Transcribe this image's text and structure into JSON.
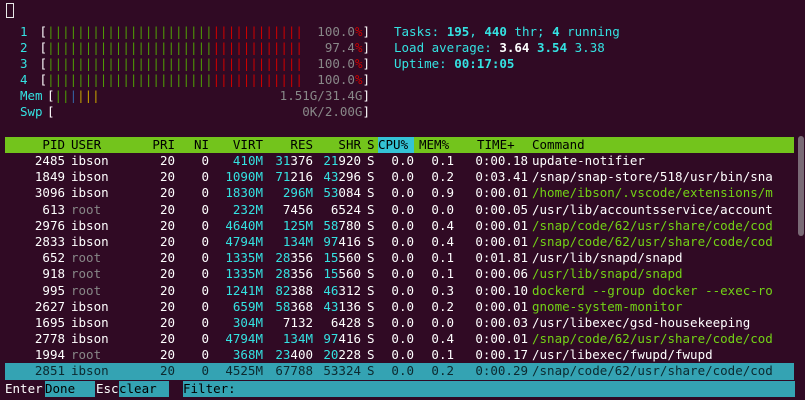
{
  "cpu_meters": [
    {
      "label": "1",
      "bars": "||||||||||||||||||||||||||||||||||",
      "value": "100.0%"
    },
    {
      "label": "2",
      "bars": "||||||||||||||||||||||||||||||||||",
      "value": "97.4%"
    },
    {
      "label": "3",
      "bars": "||||||||||||||||||||||||||||||||||",
      "value": "100.0%"
    },
    {
      "label": "4",
      "bars": "||||||||||||||||||||||||||||||||||",
      "value": "100.0%"
    }
  ],
  "mem": {
    "label": "Mem",
    "value": "1.51G/31.4G"
  },
  "swp": {
    "label": "Swp",
    "value": "0K/2.00G"
  },
  "summary": {
    "tasks_label": "Tasks: ",
    "tasks": "195",
    "sep1": ", ",
    "threads": "440",
    "thr_label": " thr; ",
    "running": "4",
    "running_label": " running",
    "load_label": "Load average: ",
    "load1": "3.64",
    "load5": "3.54",
    "load15": "3.38",
    "uptime_label": "Uptime: ",
    "uptime": "00:17:05"
  },
  "header": {
    "pid": "PID",
    "user": "USER",
    "pri": "PRI",
    "ni": "NI",
    "virt": "VIRT",
    "res": "RES",
    "shr": "SHR",
    "s": "S",
    "cpu": "CPU%",
    "mem": "MEM%",
    "time": "TIME+",
    "cmd": "Command"
  },
  "processes": [
    {
      "pid": "2485",
      "user": "ibson",
      "pri": "20",
      "ni": "0",
      "virt": "410M",
      "res": "31376",
      "shr": "21920",
      "s": "S",
      "cpu": "0.0",
      "mem": "0.1",
      "time": "0:00.18",
      "cmd": "update-notifier",
      "cmd_color": "white"
    },
    {
      "pid": "1849",
      "user": "ibson",
      "pri": "20",
      "ni": "0",
      "virt": "1090M",
      "res": "71216",
      "shr": "43296",
      "s": "S",
      "cpu": "0.0",
      "mem": "0.2",
      "time": "0:03.41",
      "cmd": "/snap/snap-store/518/usr/bin/sna",
      "cmd_color": "white"
    },
    {
      "pid": "3096",
      "user": "ibson",
      "pri": "20",
      "ni": "0",
      "virt": "1830M",
      "res": "296M",
      "shr": "53084",
      "s": "S",
      "cpu": "0.0",
      "mem": "0.9",
      "time": "0:00.01",
      "cmd": "/home/ibson/.vscode/extensions/m",
      "cmd_color": "green"
    },
    {
      "pid": "613",
      "user": "root",
      "pri": "20",
      "ni": "0",
      "virt": "232M",
      "res": "7456",
      "shr": "6524",
      "s": "S",
      "cpu": "0.0",
      "mem": "0.0",
      "time": "0:00.05",
      "cmd": "/usr/lib/accountsservice/account",
      "cmd_color": "white"
    },
    {
      "pid": "2976",
      "user": "ibson",
      "pri": "20",
      "ni": "0",
      "virt": "4640M",
      "res": "125M",
      "shr": "58780",
      "s": "S",
      "cpu": "0.0",
      "mem": "0.4",
      "time": "0:00.01",
      "cmd": "/snap/code/62/usr/share/code/cod",
      "cmd_color": "green"
    },
    {
      "pid": "2833",
      "user": "ibson",
      "pri": "20",
      "ni": "0",
      "virt": "4794M",
      "res": "134M",
      "shr": "97416",
      "s": "S",
      "cpu": "0.0",
      "mem": "0.4",
      "time": "0:00.01",
      "cmd": "/snap/code/62/usr/share/code/cod",
      "cmd_color": "green"
    },
    {
      "pid": "652",
      "user": "root",
      "pri": "20",
      "ni": "0",
      "virt": "1335M",
      "res": "28356",
      "shr": "15560",
      "s": "S",
      "cpu": "0.0",
      "mem": "0.1",
      "time": "0:01.81",
      "cmd": "/usr/lib/snapd/snapd",
      "cmd_color": "white"
    },
    {
      "pid": "918",
      "user": "root",
      "pri": "20",
      "ni": "0",
      "virt": "1335M",
      "res": "28356",
      "shr": "15560",
      "s": "S",
      "cpu": "0.0",
      "mem": "0.1",
      "time": "0:00.06",
      "cmd": "/usr/lib/snapd/snapd",
      "cmd_color": "green"
    },
    {
      "pid": "995",
      "user": "root",
      "pri": "20",
      "ni": "0",
      "virt": "1241M",
      "res": "82388",
      "shr": "46312",
      "s": "S",
      "cpu": "0.0",
      "mem": "0.3",
      "time": "0:00.10",
      "cmd": "dockerd --group docker --exec-ro",
      "cmd_color": "green"
    },
    {
      "pid": "2627",
      "user": "ibson",
      "pri": "20",
      "ni": "0",
      "virt": "659M",
      "res": "58368",
      "shr": "43136",
      "s": "S",
      "cpu": "0.0",
      "mem": "0.2",
      "time": "0:00.01",
      "cmd": "gnome-system-monitor",
      "cmd_color": "green"
    },
    {
      "pid": "1695",
      "user": "ibson",
      "pri": "20",
      "ni": "0",
      "virt": "304M",
      "res": "7132",
      "shr": "6428",
      "s": "S",
      "cpu": "0.0",
      "mem": "0.0",
      "time": "0:00.03",
      "cmd": "/usr/libexec/gsd-housekeeping",
      "cmd_color": "white"
    },
    {
      "pid": "2778",
      "user": "ibson",
      "pri": "20",
      "ni": "0",
      "virt": "4794M",
      "res": "134M",
      "shr": "97416",
      "s": "S",
      "cpu": "0.0",
      "mem": "0.4",
      "time": "0:00.01",
      "cmd": "/snap/code/62/usr/share/code/cod",
      "cmd_color": "green"
    },
    {
      "pid": "1994",
      "user": "root",
      "pri": "20",
      "ni": "0",
      "virt": "368M",
      "res": "23400",
      "shr": "20228",
      "s": "S",
      "cpu": "0.0",
      "mem": "0.1",
      "time": "0:00.17",
      "cmd": "/usr/libexec/fwupd/fwupd",
      "cmd_color": "white"
    },
    {
      "pid": "2851",
      "user": "ibson",
      "pri": "20",
      "ni": "0",
      "virt": "4525M",
      "res": "67788",
      "shr": "53324",
      "s": "S",
      "cpu": "0.0",
      "mem": "0.2",
      "time": "0:00.29",
      "cmd": "/snap/code/62/usr/share/code/cod",
      "cmd_color": "white",
      "selected": true
    }
  ],
  "footer": {
    "key1": "Enter",
    "label1": "Done",
    "key2": "Esc",
    "label2": "clear",
    "filter_label": "Filter: "
  },
  "colors": {
    "background": "#300a24",
    "header_bg": "#73c41c",
    "selected_bg": "#34a3b3",
    "cyan": "#34e2e2",
    "green": "#73d216",
    "red": "#cc0000"
  }
}
